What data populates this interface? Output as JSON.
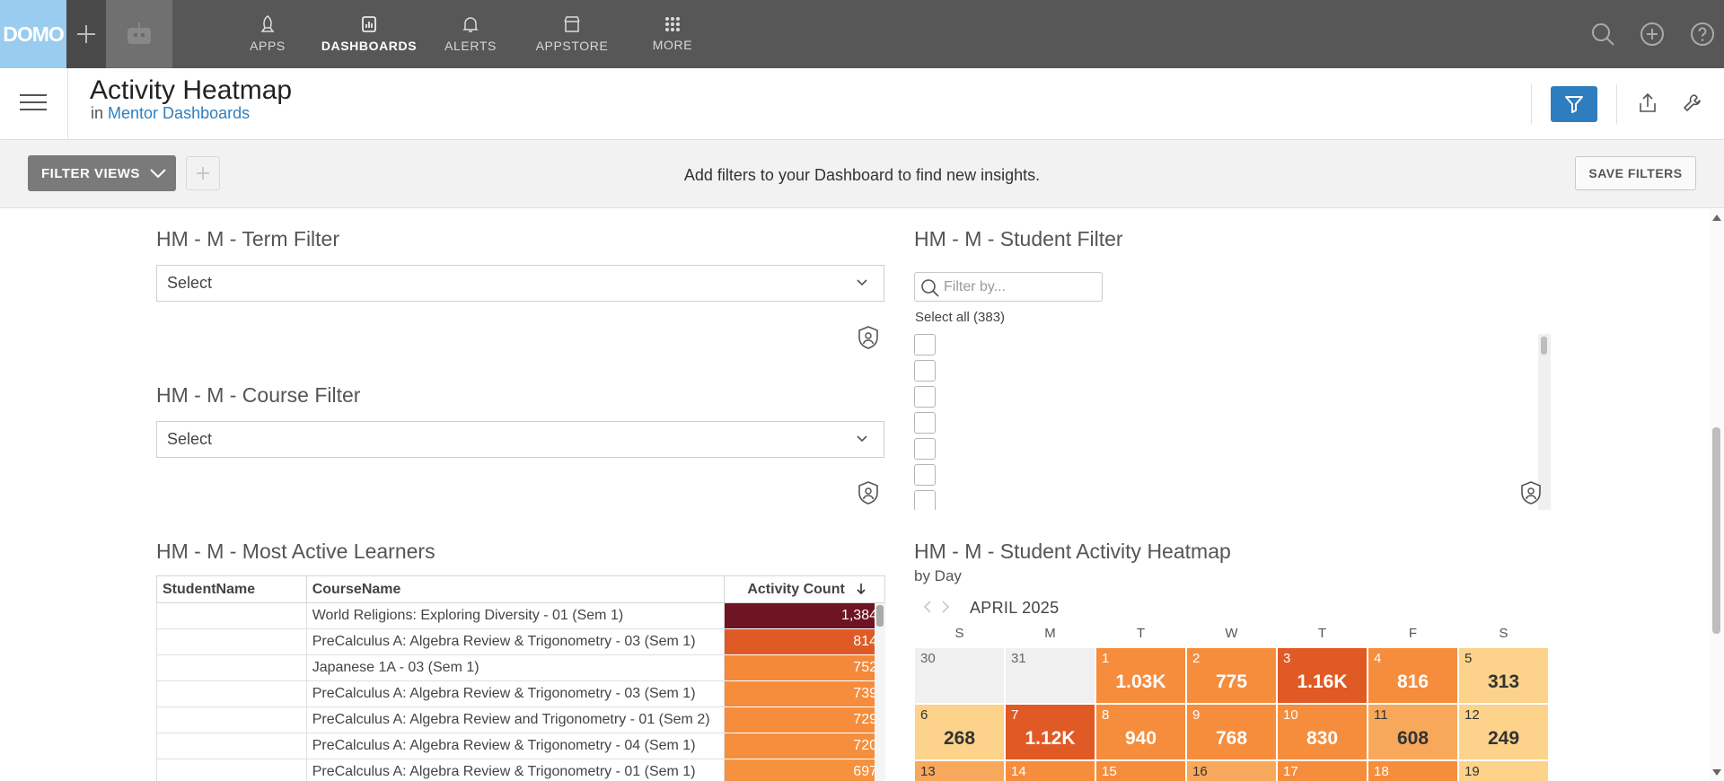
{
  "app": {
    "logo": "DOMO"
  },
  "nav": {
    "items": [
      {
        "label": "APPS",
        "icon": "rocket-icon"
      },
      {
        "label": "DASHBOARDS",
        "icon": "dashboard-icon",
        "active": true
      },
      {
        "label": "ALERTS",
        "icon": "bell-icon"
      },
      {
        "label": "APPSTORE",
        "icon": "store-icon"
      },
      {
        "label": "MORE",
        "icon": "grid-icon"
      }
    ],
    "right_icons": [
      "search-icon",
      "plus-circle-icon",
      "help-icon"
    ]
  },
  "header": {
    "title": "Activity Heatmap",
    "breadcrumb_prefix": "in",
    "breadcrumb_link": "Mentor Dashboards"
  },
  "filterbar": {
    "filter_views_label": "FILTER VIEWS",
    "hint": "Add filters to your Dashboard to find new insights.",
    "save_label": "SAVE FILTERS"
  },
  "cards": {
    "term_filter": {
      "title": "HM - M - Term Filter",
      "value": "Select"
    },
    "course_filter": {
      "title": "HM - M - Course Filter",
      "value": "Select"
    },
    "student_filter": {
      "title": "HM - M - Student Filter",
      "placeholder": "Filter by...",
      "select_all": "Select all (383)",
      "checkbox_count": 7
    },
    "learners": {
      "title": "HM - M - Most Active Learners",
      "columns": [
        "StudentName",
        "CourseName",
        "Activity Count"
      ],
      "rows": [
        {
          "student": "",
          "course": "World Religions: Exploring Diversity - 01 (Sem 1)",
          "count": "1,384",
          "color": "#6e1423",
          "value": 1384
        },
        {
          "student": "",
          "course": "PreCalculus A: Algebra Review & Trigonometry - 03 (Sem 1)",
          "count": "814",
          "color": "#e05a25",
          "value": 814
        },
        {
          "student": "",
          "course": "Japanese 1A - 03 (Sem 1)",
          "count": "752",
          "color": "#f4893a",
          "value": 752
        },
        {
          "student": "",
          "course": "PreCalculus A: Algebra Review & Trigonometry - 03 (Sem 1)",
          "count": "739",
          "color": "#f58d3c",
          "value": 739
        },
        {
          "student": "",
          "course": "PreCalculus A: Algebra Review and Trigonometry - 01 (Sem 2)",
          "count": "729",
          "color": "#f58d3c",
          "value": 729
        },
        {
          "student": "",
          "course": "PreCalculus A: Algebra Review & Trigonometry - 04 (Sem 1)",
          "count": "720",
          "color": "#f58f3d",
          "value": 720
        },
        {
          "student": "",
          "course": "PreCalculus A: Algebra Review & Trigonometry - 01 (Sem 1)",
          "count": "697",
          "color": "#f5923f",
          "value": 697
        }
      ]
    },
    "heatmap": {
      "title": "HM - M - Student Activity Heatmap",
      "subtitle": "by Day",
      "month": "APRIL 2025",
      "weekdays": [
        "S",
        "M",
        "T",
        "W",
        "T",
        "F",
        "S"
      ],
      "weeks": [
        [
          {
            "day": "30",
            "value": "",
            "color": "#f0f0f0",
            "text": "#666"
          },
          {
            "day": "31",
            "value": "",
            "color": "#f0f0f0",
            "text": "#666"
          },
          {
            "day": "1",
            "value": "1.03K",
            "color": "#f58d3c",
            "text": "#fff"
          },
          {
            "day": "2",
            "value": "775",
            "color": "#f58d3c",
            "text": "#fff"
          },
          {
            "day": "3",
            "value": "1.16K",
            "color": "#e05a25",
            "text": "#fff"
          },
          {
            "day": "4",
            "value": "816",
            "color": "#f58d3c",
            "text": "#fff"
          },
          {
            "day": "5",
            "value": "313",
            "color": "#fdd28a",
            "text": "#333"
          }
        ],
        [
          {
            "day": "6",
            "value": "268",
            "color": "#fdd28a",
            "text": "#333"
          },
          {
            "day": "7",
            "value": "1.12K",
            "color": "#e05a25",
            "text": "#fff"
          },
          {
            "day": "8",
            "value": "940",
            "color": "#f58d3c",
            "text": "#fff"
          },
          {
            "day": "9",
            "value": "768",
            "color": "#f58d3c",
            "text": "#fff"
          },
          {
            "day": "10",
            "value": "830",
            "color": "#f58d3c",
            "text": "#fff"
          },
          {
            "day": "11",
            "value": "608",
            "color": "#f8a85a",
            "text": "#333"
          },
          {
            "day": "12",
            "value": "249",
            "color": "#fdd28a",
            "text": "#333"
          }
        ],
        [
          {
            "day": "13",
            "value": "",
            "color": "#f8a85a",
            "text": "#333"
          },
          {
            "day": "14",
            "value": "",
            "color": "#f58d3c",
            "text": "#fff"
          },
          {
            "day": "15",
            "value": "",
            "color": "#f58d3c",
            "text": "#fff"
          },
          {
            "day": "16",
            "value": "",
            "color": "#f8a85a",
            "text": "#333"
          },
          {
            "day": "17",
            "value": "",
            "color": "#f58d3c",
            "text": "#fff"
          },
          {
            "day": "18",
            "value": "",
            "color": "#f58d3c",
            "text": "#fff"
          },
          {
            "day": "19",
            "value": "",
            "color": "#fdd28a",
            "text": "#333"
          }
        ]
      ]
    }
  }
}
